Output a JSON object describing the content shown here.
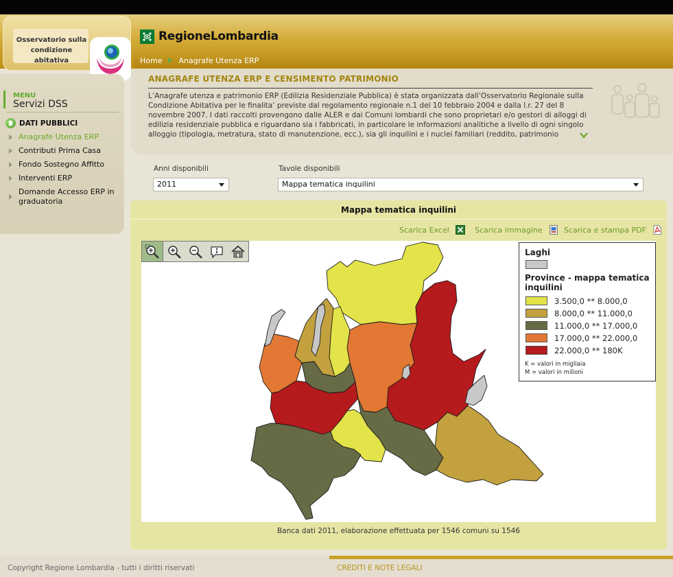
{
  "header": {
    "logo_text": "Osservatorio sulla condizione abitativa",
    "brand_name": "RegioneLombardia",
    "breadcrumb": [
      "Home",
      "Anagrafe Utenza ERP"
    ]
  },
  "intro": {
    "title": "ANAGRAFE UTENZA ERP E CENSIMENTO PATRIMONIO",
    "text": "L’Anagrafe utenza e patrimonio ERP (Edilizia Residenziale Pubblica) è stata organizzata dall’Osservatorio Regionale sulla Condizione Abitativa per le finalita’ previste dal regolamento regionale n.1 del 10 febbraio 2004 e dalla l.r. 27 del 8 novembre 2007. I dati raccolti provengono dalle ALER e dai Comuni lombardi che sono proprietari e/o gestori di alloggi di edilizia residenziale pubblica e riguardano sia i fabbricati, in particolare le informazioni analitiche a livello di ogni singolo alloggio (tipologia, metratura, stato di manutenzione, ecc.), sia gli inquilini e i nuclei familiari (reddito, patrimonio mobiliare e"
  },
  "sidebar": {
    "menu_label": "MENU",
    "menu_title": "Servizi DSS",
    "section": "DATI PUBBLICI",
    "items": [
      {
        "label": "Anagrafe Utenza ERP",
        "active": true
      },
      {
        "label": "Contributi Prima Casa"
      },
      {
        "label": "Fondo Sostegno Affitto"
      },
      {
        "label": "Interventi ERP"
      },
      {
        "label": "Domande Accesso ERP in graduatoria"
      }
    ]
  },
  "filters": {
    "years_label": "Anni disponibili",
    "years_value": "2011",
    "tables_label": "Tavole disponibili",
    "tables_value": "Mappa tematica inquilini"
  },
  "map_panel": {
    "title": "Mappa tematica inquilini",
    "downloads": [
      "Scarica Excel",
      "Scarica immagine",
      "Scarica e stampa PDF"
    ],
    "caption": "Banca dati 2011, elaborazione effettuata per 1546 comuni su 1546"
  },
  "legend": {
    "lakes_title": "Laghi",
    "provinces_title": "Province - mappa tematica inquilini",
    "classes": [
      {
        "label": "3.500,0 ** 8.000,0",
        "color": "#e3e34a"
      },
      {
        "label": "8.000,0 ** 11.000,0",
        "color": "#c2a13e"
      },
      {
        "label": "11.000,0 ** 17.000,0",
        "color": "#666b45"
      },
      {
        "label": "17.000,0 ** 22.000,0",
        "color": "#e27833"
      },
      {
        "label": "22.000,0 ** 180K",
        "color": "#b51a1c"
      }
    ],
    "lakes_color": "#c8c8c8",
    "notes": [
      "K = valori in migliaia",
      "M = valori in milioni"
    ]
  },
  "footer": {
    "copyright": "Copyright Regione Lombardia - tutti i diritti riservati",
    "link": "CREDITI E NOTE LEGALI"
  }
}
